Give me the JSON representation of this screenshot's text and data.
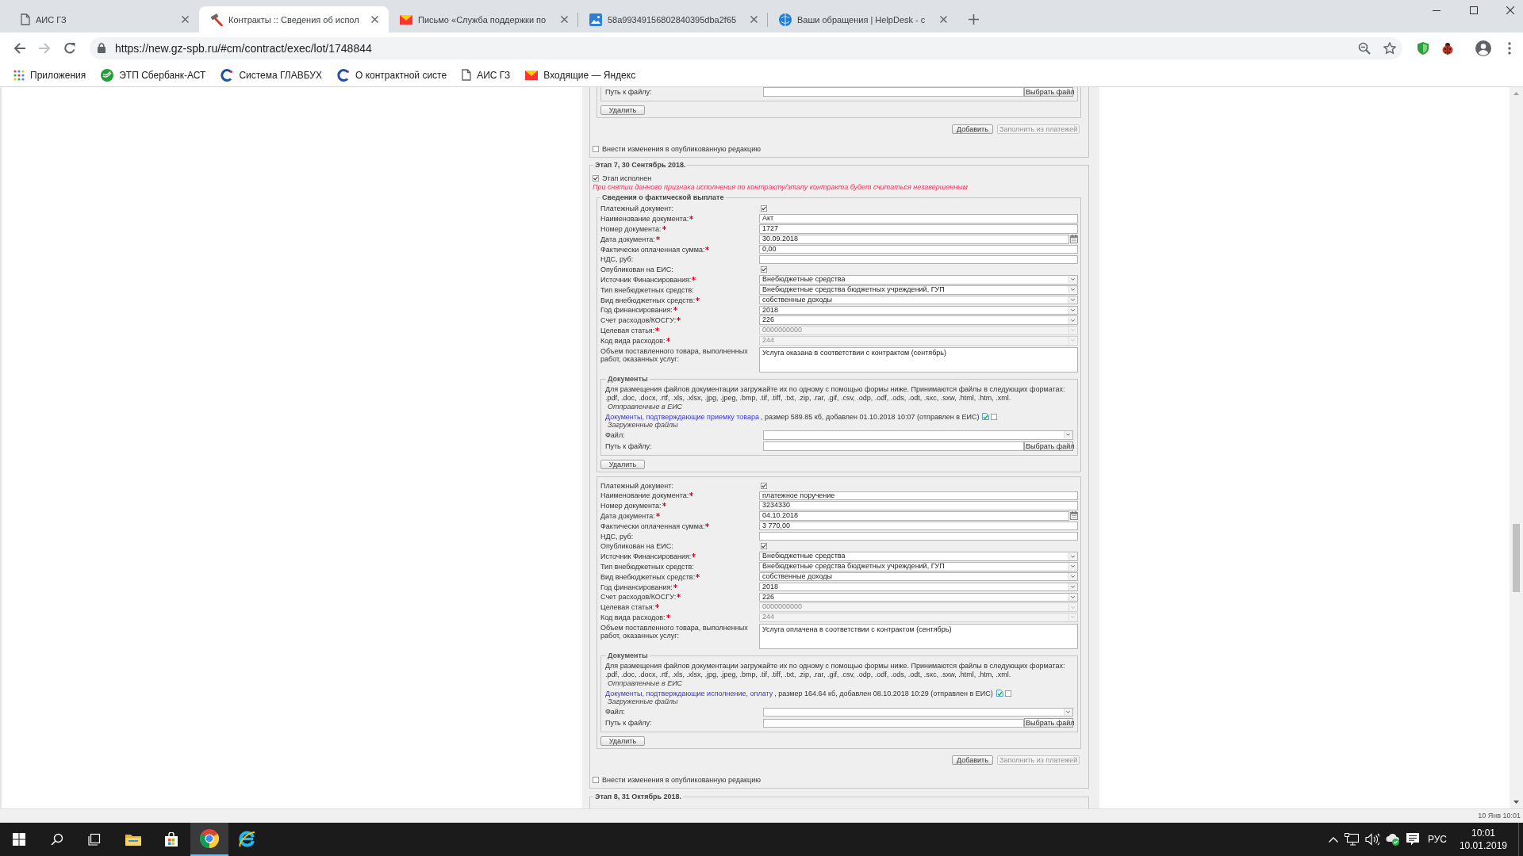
{
  "browser": {
    "tabs": [
      {
        "kind": "page",
        "title": "АИС ГЗ",
        "selected": false
      },
      {
        "kind": "tool",
        "title": "Контракты :: Сведения об испол",
        "selected": true
      },
      {
        "kind": "mail",
        "title": "Письмо «Служба поддержки по",
        "selected": false
      },
      {
        "kind": "image",
        "title": "58a99349156802840395dba2f65",
        "selected": false
      },
      {
        "kind": "help",
        "title": "Ваши обращения | HelpDesk - с",
        "selected": false
      }
    ],
    "url": "https://new.gz-spb.ru/#cm/contract/exec/lot/1748844",
    "bookmarks": [
      {
        "kind": "apps",
        "label": "Приложения"
      },
      {
        "kind": "leaf",
        "label": "ЭТП Сбербанк-АСТ"
      },
      {
        "kind": "ring",
        "label": "Система ГЛАВБУХ"
      },
      {
        "kind": "ring",
        "label": "О контрактной систе"
      },
      {
        "kind": "page",
        "label": "АИС ГЗ"
      },
      {
        "kind": "mail",
        "label": "Входящие — Яндекс"
      }
    ]
  },
  "page": {
    "previous_stage": {
      "path_label": "Путь к файлу:",
      "choose_file": "Выбрать файл",
      "delete": "Удалить",
      "add": {
        "label": "Добавить",
        "disabled": false
      },
      "fill": {
        "label": "Заполнить из платежей",
        "disabled": true
      },
      "publish": {
        "label": "Внести изменения в опубликованную редакцию",
        "checked": false
      }
    },
    "stages": [
      {
        "legend": "Этап 7, 30 Сентябрь 2018.",
        "done": {
          "label": "Этап исполнен",
          "checked": true
        },
        "warning": "При снятии данного признака исполнения по контракту/этапу контракта будет считаться незавершенным",
        "payments_title": "Сведения о фактической выплате",
        "payments": [
          {
            "fields": [
              {
                "kind": "checkbox",
                "label": "Платежный документ:",
                "required": false,
                "disabled": false,
                "checked": true
              },
              {
                "kind": "text",
                "label": "Наименование документа:",
                "required": true,
                "disabled": false,
                "value": "Акт"
              },
              {
                "kind": "text",
                "label": "Номер документа:",
                "required": true,
                "disabled": false,
                "value": "1727"
              },
              {
                "kind": "date",
                "label": "Дата документа:",
                "required": true,
                "disabled": false,
                "value": "30.09.2018"
              },
              {
                "kind": "text",
                "label": "Фактически оплаченная сумма:",
                "required": true,
                "disabled": false,
                "value": "0,00"
              },
              {
                "kind": "text",
                "label": "НДС, руб:",
                "required": false,
                "disabled": false
              },
              {
                "kind": "checkbox",
                "label": "Опубликован на ЕИС:",
                "required": false,
                "disabled": false,
                "checked": true
              },
              {
                "kind": "select",
                "label": "Источник Финансирования:",
                "required": true,
                "disabled": false,
                "value": "Внебюджетные средства"
              },
              {
                "kind": "select",
                "label": "Тип внебюджетных средств:",
                "required": false,
                "disabled": false,
                "value": "Внебюджетные средства бюджетных учреждений, ГУП"
              },
              {
                "kind": "select",
                "label": "Вид внебюджетных средств:",
                "required": true,
                "disabled": false,
                "value": "собственные доходы"
              },
              {
                "kind": "select",
                "label": "Год финансирования:",
                "required": true,
                "disabled": false,
                "value": "2018"
              },
              {
                "kind": "select",
                "label": "Счет расходов/КОСГУ:",
                "required": true,
                "disabled": false,
                "value": "226"
              },
              {
                "kind": "select",
                "label": "Целевая статья:",
                "required": true,
                "disabled": true,
                "value": "0000000000"
              },
              {
                "kind": "select",
                "label": "Код вида расходов:",
                "required": true,
                "disabled": true,
                "value": "244"
              },
              {
                "kind": "textarea",
                "label": "Объем поставленного товара, выполненных работ, оказанных услуг:",
                "required": false,
                "disabled": false,
                "value": "Услуга оказана в соответствии с контрактом (сентябрь)"
              }
            ],
            "documents": {
              "legend": "Документы",
              "intro": "Для размещения файлов документации загружайте их по одному с помощью формы ниже. Принимаются файлы в следующих форматах:",
              "formats": ".pdf, .doc, .docx, .rtf, .xls, .xlsx, .jpg, .jpeg, .bmp, .tif, .tiff, .txt, .zip, .rar, .gif, .csv, .odp, .odf, .ods, .odt, .sxc, .sxw, .html, .htm, .xml.",
              "sent_title": "Отправленные в ЕИС",
              "files": [
                {
                  "link": "Документы, подтверждающие приемку товара",
                  "info": ", размер 589.85 кб, добавлен 01.10.2018 10:07 (отправлен в ЕИС)",
                  "checked": false
                }
              ],
              "uploaded_title": "Загруженные файлы",
              "file_label": "Файл:",
              "path_label": "Путь к файлу:",
              "choose_file": "Выбрать файл"
            },
            "delete": "Удалить"
          },
          {
            "fields": [
              {
                "kind": "checkbox",
                "label": "Платежный документ:",
                "required": false,
                "disabled": false,
                "checked": true
              },
              {
                "kind": "text",
                "label": "Наименование документа:",
                "required": true,
                "disabled": false,
                "value": "платежное поручение"
              },
              {
                "kind": "text",
                "label": "Номер документа:",
                "required": true,
                "disabled": false,
                "value": "3234330"
              },
              {
                "kind": "date",
                "label": "Дата документа:",
                "required": true,
                "disabled": false,
                "value": "04.10.2018"
              },
              {
                "kind": "text",
                "label": "Фактически оплаченная сумма:",
                "required": true,
                "disabled": false,
                "value": "3 770,00"
              },
              {
                "kind": "text",
                "label": "НДС, руб:",
                "required": false,
                "disabled": false
              },
              {
                "kind": "checkbox",
                "label": "Опубликован на ЕИС:",
                "required": false,
                "disabled": false,
                "checked": true
              },
              {
                "kind": "select",
                "label": "Источник Финансирования:",
                "required": true,
                "disabled": false,
                "value": "Внебюджетные средства"
              },
              {
                "kind": "select",
                "label": "Тип внебюджетных средств:",
                "required": false,
                "disabled": false,
                "value": "Внебюджетные средства бюджетных учреждений, ГУП"
              },
              {
                "kind": "select",
                "label": "Вид внебюджетных средств:",
                "required": true,
                "disabled": false,
                "value": "собственные доходы"
              },
              {
                "kind": "select",
                "label": "Год финансирования:",
                "required": true,
                "disabled": false,
                "value": "2018"
              },
              {
                "kind": "select",
                "label": "Счет расходов/КОСГУ:",
                "required": true,
                "disabled": false,
                "value": "226"
              },
              {
                "kind": "select",
                "label": "Целевая статья:",
                "required": true,
                "disabled": true,
                "value": "0000000000"
              },
              {
                "kind": "select",
                "label": "Код вида расходов:",
                "required": true,
                "disabled": true,
                "value": "244"
              },
              {
                "kind": "textarea",
                "label": "Объем поставленного товара, выполненных работ, оказанных услуг:",
                "required": false,
                "disabled": false,
                "value": "Услуга оплачена в соответствии с контрактом (сентябрь)"
              }
            ],
            "documents": {
              "legend": "Документы",
              "intro": "Для размещения файлов документации загружайте их по одному с помощью формы ниже. Принимаются файлы в следующих форматах:",
              "formats": ".pdf, .doc, .docx, .rtf, .xls, .xlsx, .jpg, .jpeg, .bmp, .tif, .tiff, .txt, .zip, .rar, .gif, .csv, .odp, .odf, .ods, .odt, .sxc, .sxw, .html, .htm, .xml.",
              "sent_title": "Отправленные в ЕИС",
              "files": [
                {
                  "link": "Документы, подтверждающие исполнение, оплату",
                  "info": ", размер 164.64 кб, добавлен 08.10.2018 10:29 (отправлен в ЕИС)",
                  "checked": false
                }
              ],
              "uploaded_title": "Загруженные файлы",
              "file_label": "Файл:",
              "path_label": "Путь к файлу:",
              "choose_file": "Выбрать файл"
            },
            "delete": "Удалить"
          }
        ],
        "add": {
          "label": "Добавить",
          "disabled": false
        },
        "fill": {
          "label": "Заполнить из платежей",
          "disabled": true
        },
        "publish": {
          "label": "Внести изменения в опубликованную редакцию",
          "checked": false
        }
      },
      {
        "legend": "Этап 8, 31 Октябрь 2018."
      }
    ]
  },
  "footer": {
    "timestamp": "10 Янв 10:01"
  },
  "taskbar": {
    "apps": [
      {
        "kind": "explorer",
        "selected": false
      },
      {
        "kind": "store",
        "selected": false
      },
      {
        "kind": "chrome",
        "selected": true
      },
      {
        "kind": "ie",
        "selected": false
      }
    ],
    "language": "РУС",
    "time": "10:01",
    "date": "10.01.2019"
  }
}
